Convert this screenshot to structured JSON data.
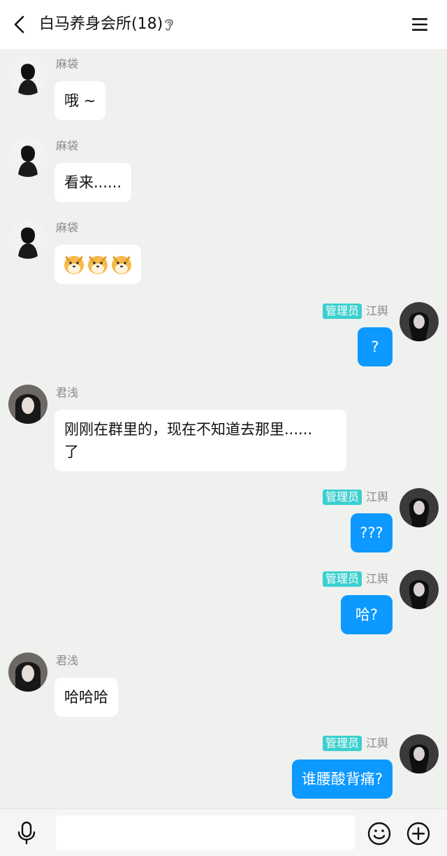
{
  "header": {
    "title": "白马养身会所(18)",
    "back_icon": "chevron-left-icon",
    "ear_icon": "ear-icon",
    "menu_icon": "hamburger-menu-icon"
  },
  "messages": [
    {
      "side": "left",
      "name": "麻袋",
      "text": "哦 ~"
    },
    {
      "side": "left",
      "name": "麻袋",
      "text": "看来......"
    },
    {
      "side": "left",
      "name": "麻袋",
      "text": "",
      "emoji": "doge-emoji x3"
    },
    {
      "side": "right",
      "badge": "管理员",
      "name": "江舆",
      "text": "?"
    },
    {
      "side": "left",
      "name": "君浅",
      "line1": "刚刚在群里的，现在不知道去那里......",
      "line2": "了"
    },
    {
      "side": "right",
      "badge": "管理员",
      "name": "江舆",
      "text": "???"
    },
    {
      "side": "right",
      "badge": "管理员",
      "name": "江舆",
      "text": "哈?"
    },
    {
      "side": "left",
      "name": "君浅",
      "text": "哈哈哈"
    },
    {
      "side": "right",
      "badge": "管理员",
      "name": "江舆",
      "text": "谁腰酸背痛?"
    }
  ],
  "input_bar": {
    "placeholder": "",
    "mic_icon": "microphone-icon",
    "emoji_icon": "smiley-icon",
    "plus_icon": "plus-circle-icon"
  },
  "colors": {
    "background": "#eef1ee",
    "bubble_self": "#0d99ff",
    "bubble_other": "#ffffff",
    "admin_badge": "#3dcfcf"
  }
}
